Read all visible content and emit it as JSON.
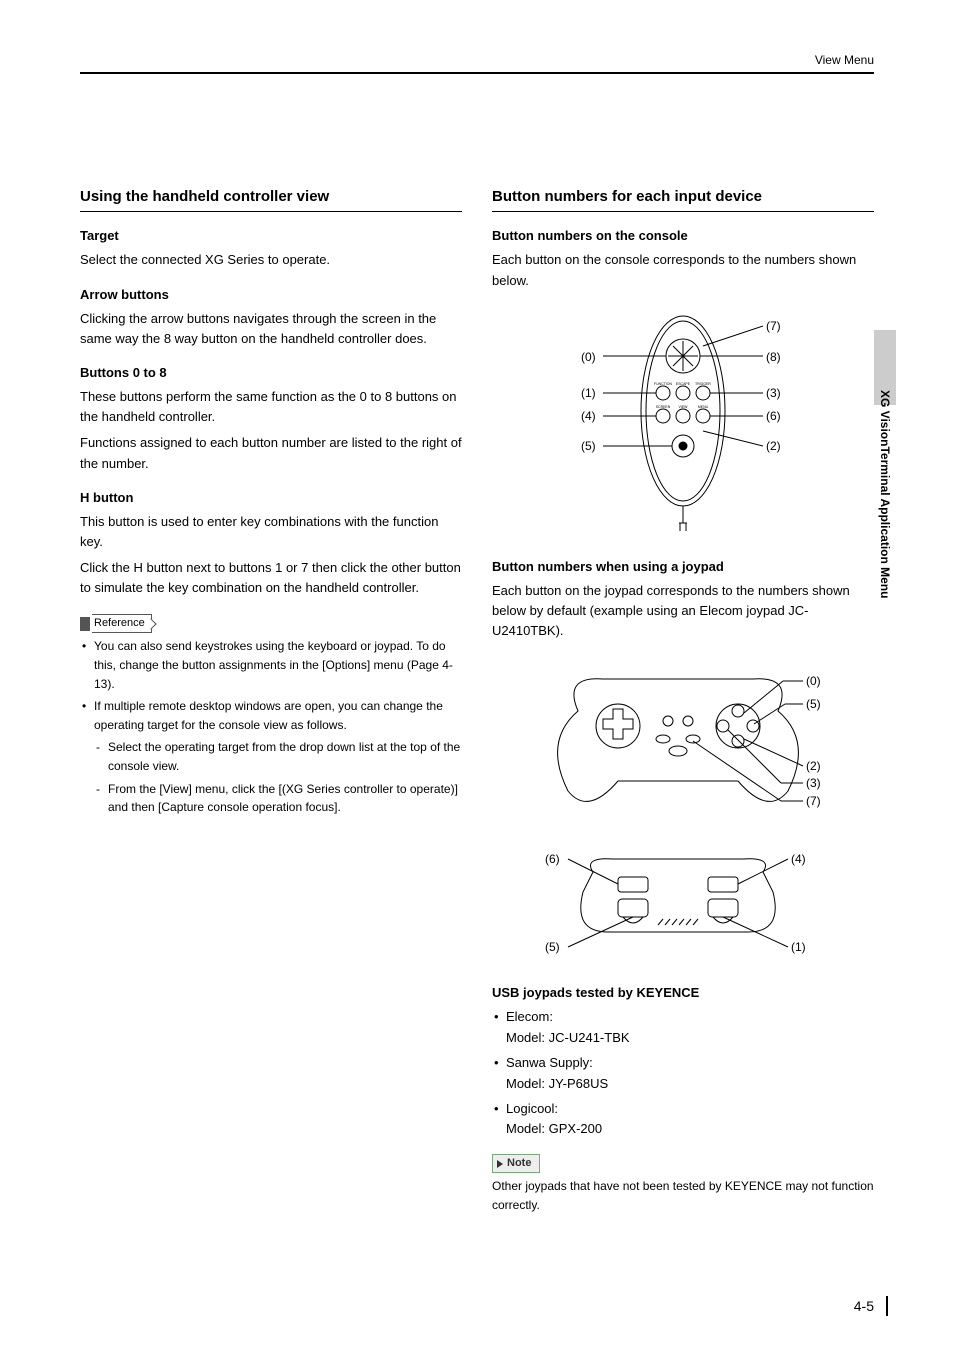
{
  "header": {
    "label": "View Menu"
  },
  "side_tab": "XG VisionTerminal Application Menu",
  "page_number": "4-5",
  "left": {
    "h2": "Using the handheld controller view",
    "target_h": "Target",
    "target_p": "Select the connected XG Series to operate.",
    "arrow_h": "Arrow buttons",
    "arrow_p": "Clicking the arrow buttons navigates through the screen in the same way the 8 way button on the handheld controller does.",
    "b08_h": "Buttons 0 to 8",
    "b08_p1": "These buttons perform the same function as the 0 to 8 buttons on the handheld controller.",
    "b08_p2": "Functions assigned to each button number are listed to the right of the number.",
    "hbtn_h": "H button",
    "hbtn_p1": "This button is used to enter key combinations with the function key.",
    "hbtn_p2": "Click the H button next to buttons 1 or 7 then click the other button to simulate the key combination on the handheld controller.",
    "ref_label": "Reference",
    "ref_items": [
      "You can also send keystrokes using the keyboard or joypad. To do this, change the button assignments in the [Options] menu (Page 4-13).",
      "If multiple remote desktop windows are open, you can change the operating target for the console view as follows."
    ],
    "ref_sub": [
      "Select the operating target from the drop down list at the top of the console view.",
      "From the [View] menu, click the [(XG Series controller to operate)] and then [Capture console operation focus]."
    ]
  },
  "right": {
    "h2": "Button numbers for each input device",
    "console_h": "Button numbers on the console",
    "console_p": "Each button on the console corresponds to the numbers shown below.",
    "console_labels": {
      "l0": "(0)",
      "l1": "(1)",
      "l4": "(4)",
      "l5": "(5)",
      "r7": "(7)",
      "r8": "(8)",
      "r3": "(3)",
      "r6": "(6)",
      "r2": "(2)"
    },
    "console_btn_labels": {
      "func": "FUNCTION",
      "trig": "TRIGGER",
      "esc": "ESCAPE",
      "scr": "SCREEN",
      "menu": "MENU",
      "view": "VIEW"
    },
    "joypad_h": "Button numbers when using a joypad",
    "joypad_p": "Each button on the joypad corresponds to the numbers shown below by default (example using an Elecom joypad JC-U2410TBK).",
    "joy_top_labels": {
      "r0": "(0)",
      "r5": "(5)",
      "r2": "(2)",
      "r3": "(3)",
      "r7": "(7)"
    },
    "joy_side_labels": {
      "l6": "(6)",
      "r4": "(4)",
      "l5": "(5)",
      "r1": "(1)"
    },
    "usb_h": "USB joypads tested by KEYENCE",
    "usb_items": [
      {
        "brand": "Elecom:",
        "model": "Model: JC-U241-TBK"
      },
      {
        "brand": "Sanwa Supply:",
        "model": "Model: JY-P68US"
      },
      {
        "brand": "Logicool:",
        "model": "Model: GPX-200"
      }
    ],
    "note_label": "Note",
    "note_p": "Other joypads that have not been tested by KEYENCE may not function correctly."
  }
}
